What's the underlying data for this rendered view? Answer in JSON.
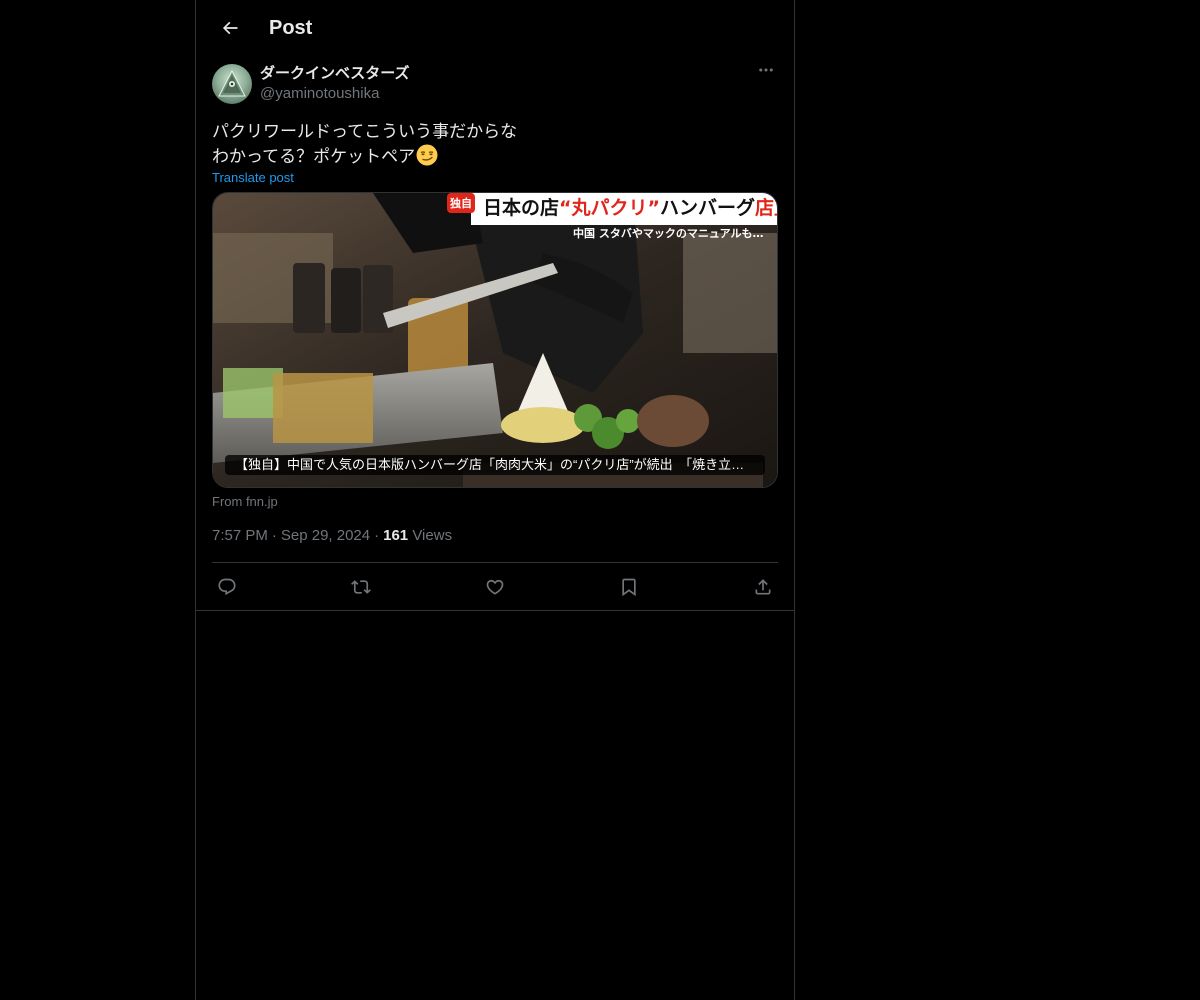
{
  "header": {
    "title": "Post"
  },
  "post": {
    "author": {
      "display_name": "ダークインベスターズ",
      "handle": "@yaminotoushika"
    },
    "text_line1": "パクリワールドってこういう事だからな",
    "text_line2": "わかってる？ポケットペア",
    "emoji": "smirking-face-emoji",
    "translate_label": "Translate post",
    "media": {
      "overlay_badge": "独自",
      "overlay_headline_pre": "日本の店",
      "overlay_headline_quote": "“丸パクリ”",
      "overlay_headline_mid": "ハンバーグ",
      "overlay_headline_post": "店直撃",
      "overlay_subtitle": "中国 スタバやマックのマニュアルも…",
      "caption": "【独自】中国で人気の日本版ハンバーグ店「肉肉大米」の“パクリ店”が続出　「焼き立てハンバーグ」"
    },
    "source": "From fnn.jp",
    "time": "7:57 PM",
    "date": "Sep 29, 2024",
    "views_count": "161",
    "views_label": "Views"
  },
  "icons": {
    "back": "arrow-left-icon",
    "more": "more-horizontal-icon",
    "reply": "reply-icon",
    "repost": "repost-icon",
    "like": "heart-icon",
    "bookmark": "bookmark-icon",
    "share": "share-icon"
  },
  "colors": {
    "background": "#000000",
    "text": "#e7e9ea",
    "secondary": "#71767b",
    "accent": "#1d9bf0",
    "border": "#2f3336"
  }
}
